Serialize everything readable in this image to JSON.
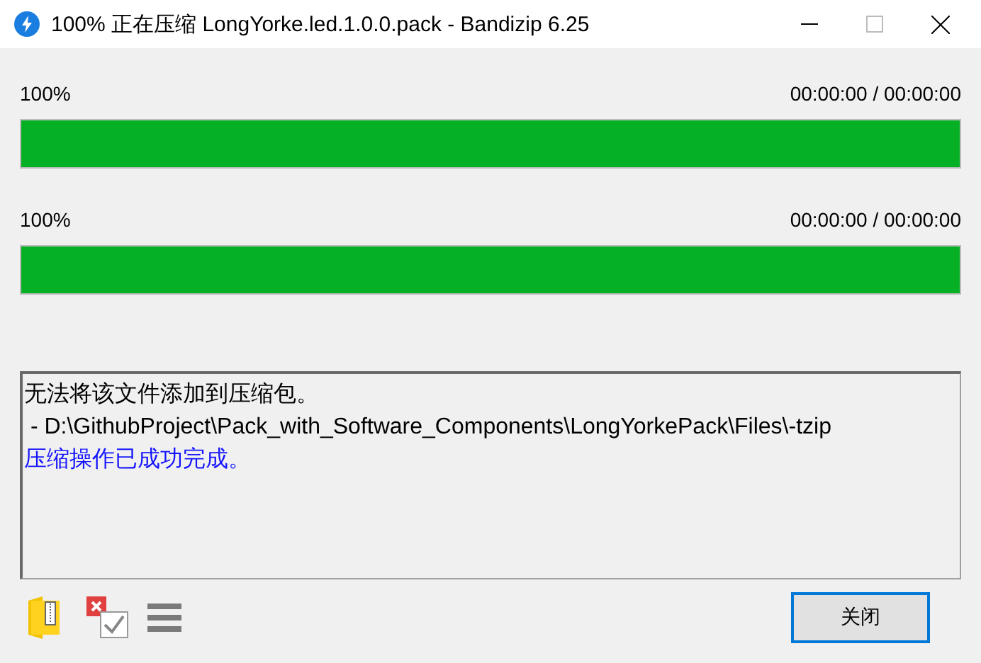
{
  "window": {
    "title": "100% 正在压缩 LongYorke.led.1.0.0.pack - Bandizip 6.25"
  },
  "progress": [
    {
      "percent": "100%",
      "time": "00:00:00 / 00:00:00",
      "level": 1
    },
    {
      "percent": "100%",
      "time": "00:00:00 / 00:00:00",
      "level": 1
    }
  ],
  "log": [
    {
      "kind": "normal",
      "text": "无法将该文件添加到压缩包。"
    },
    {
      "kind": "normal",
      "text": " - D:\\GithubProject\\Pack_with_Software_Components\\LongYorkePack\\Files\\-tzip"
    },
    {
      "kind": "success",
      "text": "压缩操作已成功完成。"
    }
  ],
  "buttons": [
    {
      "label": "关闭",
      "focused": true
    }
  ]
}
